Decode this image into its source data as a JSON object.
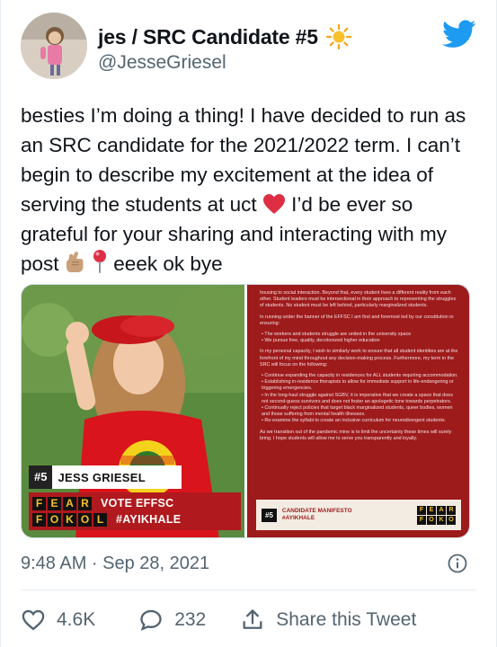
{
  "author": {
    "display_name": "jes / SRC Candidate #5",
    "handle": "@JesseGriesel"
  },
  "tweet": {
    "text_before_heart": "besties I’m doing a thing! I have decided to run as an SRC candidate for the 2021/2022 term. I can’t begin to describe my excitement at the idea of serving the students at uct ",
    "text_after_heart": " I’d be ever so grateful for your sharing and interacting with my post ",
    "text_end": " eeek ok bye"
  },
  "media": {
    "poster": {
      "number": "#5",
      "name": "JESS GRIESEL",
      "line1_letters": [
        "F",
        "E",
        "A",
        "R"
      ],
      "line1_text": "VOTE EFFSC",
      "line2_letters": [
        "F",
        "O",
        "K",
        "O",
        "L"
      ],
      "line2_text": "#AYIKHALE",
      "shirt_text": "EFF"
    },
    "manifesto": {
      "para1": "housing to social interaction. Beyond that, every student lives a different reality from each other. Student leaders must be intersectional in their approach to representing the struggles of students. No student must be left behind, particularly marginalized students.",
      "para2": "In running under the banner of the EFFSC I am first and foremost led by our constitution in ensuring:",
      "list1": [
        "• The workers and students struggle are united in the university space",
        "• We pursue free, quality, decolonized higher education"
      ],
      "para3": "In my personal capacity, I wish to similarly work to ensure that all student identities are at the forefront of my mind throughout any decision-making process. Furthermore, my term in the SRC will focus on the following:",
      "list2": [
        "• Continue expanding the capacity in residences for ALL students requiring accommodation.",
        "• Establishing in-residence therapists to allow for immediate support in life-endangering or triggering emergencies.",
        "• In the long-haul struggle against SGBV, it is imperative that we create a space that does not second-guess survivors and does not foster an apologetic tone towards perpetrators.",
        "• Continually reject policies that target black marginalized students, queer bodies, women and those suffering from mental health illnesses.",
        "• Re-examine the syllabi to create an inclusive curriculum for neurodivergent students."
      ],
      "para4": "As we transition out of the pandemic mine is to limit the uncertainty these times will surely bring. I hope students will allow me to serve you transparently and loyally.",
      "footer_number": "#5",
      "footer_title": "CANDIDATE MANIFESTO",
      "footer_tag": "#AYIKHALE",
      "footer_letters": [
        "F",
        "E",
        "A",
        "R",
        "F",
        "O",
        "K",
        "O"
      ]
    }
  },
  "meta": {
    "timestamp": "9:48 AM · Sep 28, 2021"
  },
  "actions": {
    "likes": "4.6K",
    "replies": "232",
    "share_label": "Share this Tweet"
  },
  "colors": {
    "twitter_blue": "#1d9bf0",
    "heart_red": "#e0245e",
    "eff_red": "#b0191d",
    "muted_text": "#536471"
  },
  "icons": [
    "sun-icon",
    "twitter-bird-icon",
    "red-heart-icon",
    "fingers-crossed-icon",
    "pin-icon",
    "info-icon",
    "like-icon",
    "reply-icon",
    "share-icon"
  ]
}
